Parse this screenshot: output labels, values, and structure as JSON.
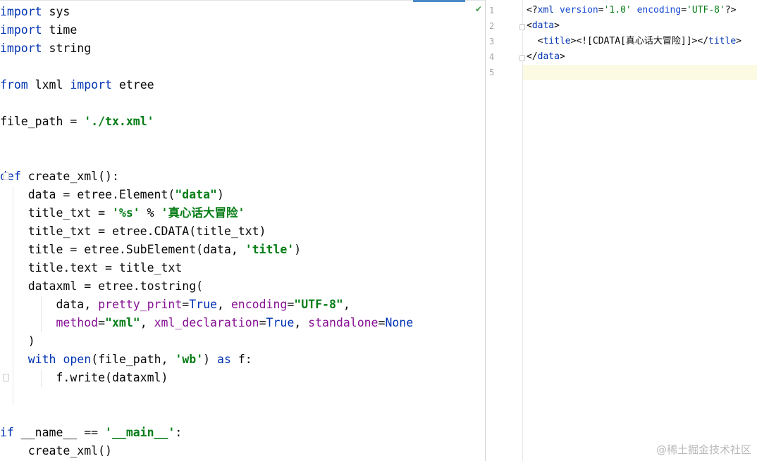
{
  "left_editor": {
    "lines": [
      [
        [
          "kw",
          "import"
        ],
        [
          "t",
          " sys"
        ]
      ],
      [
        [
          "kw",
          "import"
        ],
        [
          "t",
          " time"
        ]
      ],
      [
        [
          "kw",
          "import"
        ],
        [
          "t",
          " string"
        ]
      ],
      [],
      [
        [
          "kw",
          "from"
        ],
        [
          "t",
          " lxml "
        ],
        [
          "kw",
          "import"
        ],
        [
          "t",
          " etree"
        ]
      ],
      [],
      [
        [
          "t",
          "file_path = "
        ],
        [
          "str",
          "'./tx.xml'"
        ]
      ],
      [],
      [],
      [
        [
          "kw",
          "def"
        ],
        [
          "t",
          " create_xml():"
        ]
      ],
      [
        [
          "t",
          "    data = etree.Element("
        ],
        [
          "str",
          "\"data\""
        ],
        [
          "t",
          ")"
        ]
      ],
      [
        [
          "t",
          "    title_txt = "
        ],
        [
          "str",
          "'%s'"
        ],
        [
          "t",
          " % "
        ],
        [
          "str",
          "'真心话大冒险'"
        ]
      ],
      [
        [
          "t",
          "    title_txt = etree.CDATA(title_txt)"
        ]
      ],
      [
        [
          "t",
          "    title = etree.SubElement(data, "
        ],
        [
          "str",
          "'title'"
        ],
        [
          "t",
          ")"
        ]
      ],
      [
        [
          "t",
          "    title.text = title_txt"
        ]
      ],
      [
        [
          "t",
          "    dataxml = etree.tostring("
        ]
      ],
      [
        [
          "t",
          "        data, "
        ],
        [
          "param",
          "pretty_print"
        ],
        [
          "t",
          "="
        ],
        [
          "kw",
          "True"
        ],
        [
          "t",
          ", "
        ],
        [
          "param",
          "encoding"
        ],
        [
          "t",
          "="
        ],
        [
          "str",
          "\"UTF-8\""
        ],
        [
          "t",
          ","
        ]
      ],
      [
        [
          "t",
          "        "
        ],
        [
          "param",
          "method"
        ],
        [
          "t",
          "="
        ],
        [
          "str",
          "\"xml\""
        ],
        [
          "t",
          ", "
        ],
        [
          "param",
          "xml_declaration"
        ],
        [
          "t",
          "="
        ],
        [
          "kw",
          "True"
        ],
        [
          "t",
          ", "
        ],
        [
          "param",
          "standalone"
        ],
        [
          "t",
          "="
        ],
        [
          "kw",
          "None"
        ]
      ],
      [
        [
          "t",
          "    )"
        ]
      ],
      [
        [
          "t",
          "    "
        ],
        [
          "kw",
          "with"
        ],
        [
          "t",
          " "
        ],
        [
          "builtin",
          "open"
        ],
        [
          "t",
          "(file_path, "
        ],
        [
          "str",
          "'wb'"
        ],
        [
          "t",
          ") "
        ],
        [
          "kw",
          "as"
        ],
        [
          "t",
          " f:"
        ]
      ],
      [
        [
          "t",
          "        f.write(dataxml)"
        ]
      ],
      [],
      [],
      [
        [
          "kw",
          "if"
        ],
        [
          "t",
          " __name__ == "
        ],
        [
          "str",
          "'__main__'"
        ],
        [
          "t",
          ":"
        ]
      ],
      [
        [
          "t",
          "    create_xml()"
        ]
      ]
    ]
  },
  "right_editor": {
    "line_numbers": [
      "1",
      "2",
      "3",
      "4",
      "5"
    ],
    "lines": [
      [
        [
          "t",
          "<?"
        ],
        [
          "tag",
          "xml"
        ],
        [
          "t",
          " "
        ],
        [
          "attr",
          "version"
        ],
        [
          "t",
          "="
        ],
        [
          "aval",
          "'1.0'"
        ],
        [
          "t",
          " "
        ],
        [
          "attr",
          "encoding"
        ],
        [
          "t",
          "="
        ],
        [
          "aval",
          "'UTF-8'"
        ],
        [
          "t",
          "?>"
        ]
      ],
      [
        [
          "t",
          "<"
        ],
        [
          "tag",
          "data"
        ],
        [
          "t",
          ">"
        ]
      ],
      [
        [
          "t",
          "  <"
        ],
        [
          "tag",
          "title"
        ],
        [
          "t",
          "><![CDATA[真心话大冒险]]></"
        ],
        [
          "tag",
          "title"
        ],
        [
          "t",
          ">"
        ]
      ],
      [
        [
          "t",
          "</"
        ],
        [
          "tag",
          "data"
        ],
        [
          "t",
          ">"
        ]
      ],
      []
    ]
  },
  "status": {
    "inspection_icon": "check-icon"
  },
  "watermark": "@稀土掘金技术社区",
  "colors": {
    "keyword": "#0033b3",
    "string": "#067d17",
    "parameter": "#871094",
    "current_line": "#fcfae3"
  }
}
